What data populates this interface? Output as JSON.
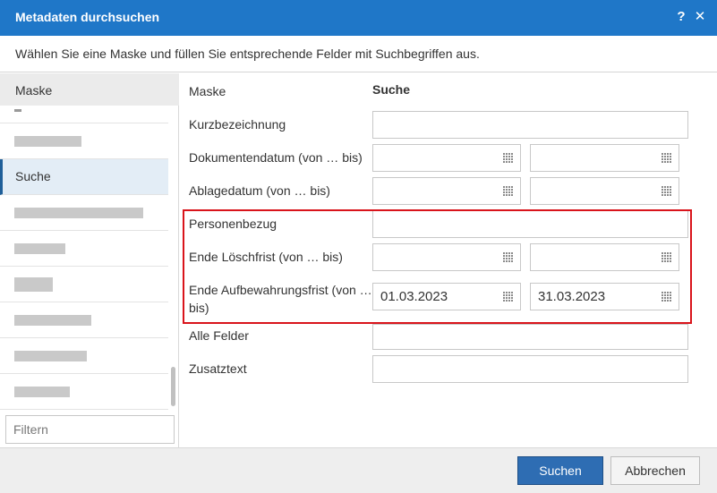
{
  "window": {
    "title": "Metadaten durchsuchen",
    "help_label": "?",
    "close_label": "✕"
  },
  "intro": "Wählen Sie eine Maske und füllen Sie entsprechende Felder mit Suchbegriffen aus.",
  "sidebar": {
    "header": "Maske",
    "items": [
      {
        "label": "",
        "selected": false
      },
      {
        "label": "Suche",
        "selected": true
      }
    ],
    "filter_placeholder": "Filtern"
  },
  "form": {
    "mask_label": "Maske",
    "mask_value": "Suche",
    "fields": {
      "kurzbezeichnung": {
        "label": "Kurzbezeichnung",
        "value": ""
      },
      "dokumentendatum": {
        "label": "Dokumentendatum (von … bis)",
        "from": "",
        "to": ""
      },
      "ablagedatum": {
        "label": "Ablagedatum (von … bis)",
        "from": "",
        "to": ""
      },
      "personenbezug": {
        "label": "Personenbezug",
        "value": ""
      },
      "ende_loeschfrist": {
        "label": "Ende Löschfrist (von … bis)",
        "from": "",
        "to": ""
      },
      "ende_aufbewahrungsfrist": {
        "label_line1": "Ende Aufbewahrungsfrist (von …",
        "label_line2": "bis)",
        "from": "01.03.2023",
        "to": "31.03.2023"
      },
      "alle_felder": {
        "label": "Alle Felder",
        "value": ""
      },
      "zusatztext": {
        "label": "Zusatztext",
        "value": ""
      }
    }
  },
  "footer": {
    "search_label": "Suchen",
    "cancel_label": "Abbrechen"
  },
  "colors": {
    "titlebar": "#1f77c8",
    "highlight": "#d9141b",
    "primary_button": "#2e6db3"
  }
}
